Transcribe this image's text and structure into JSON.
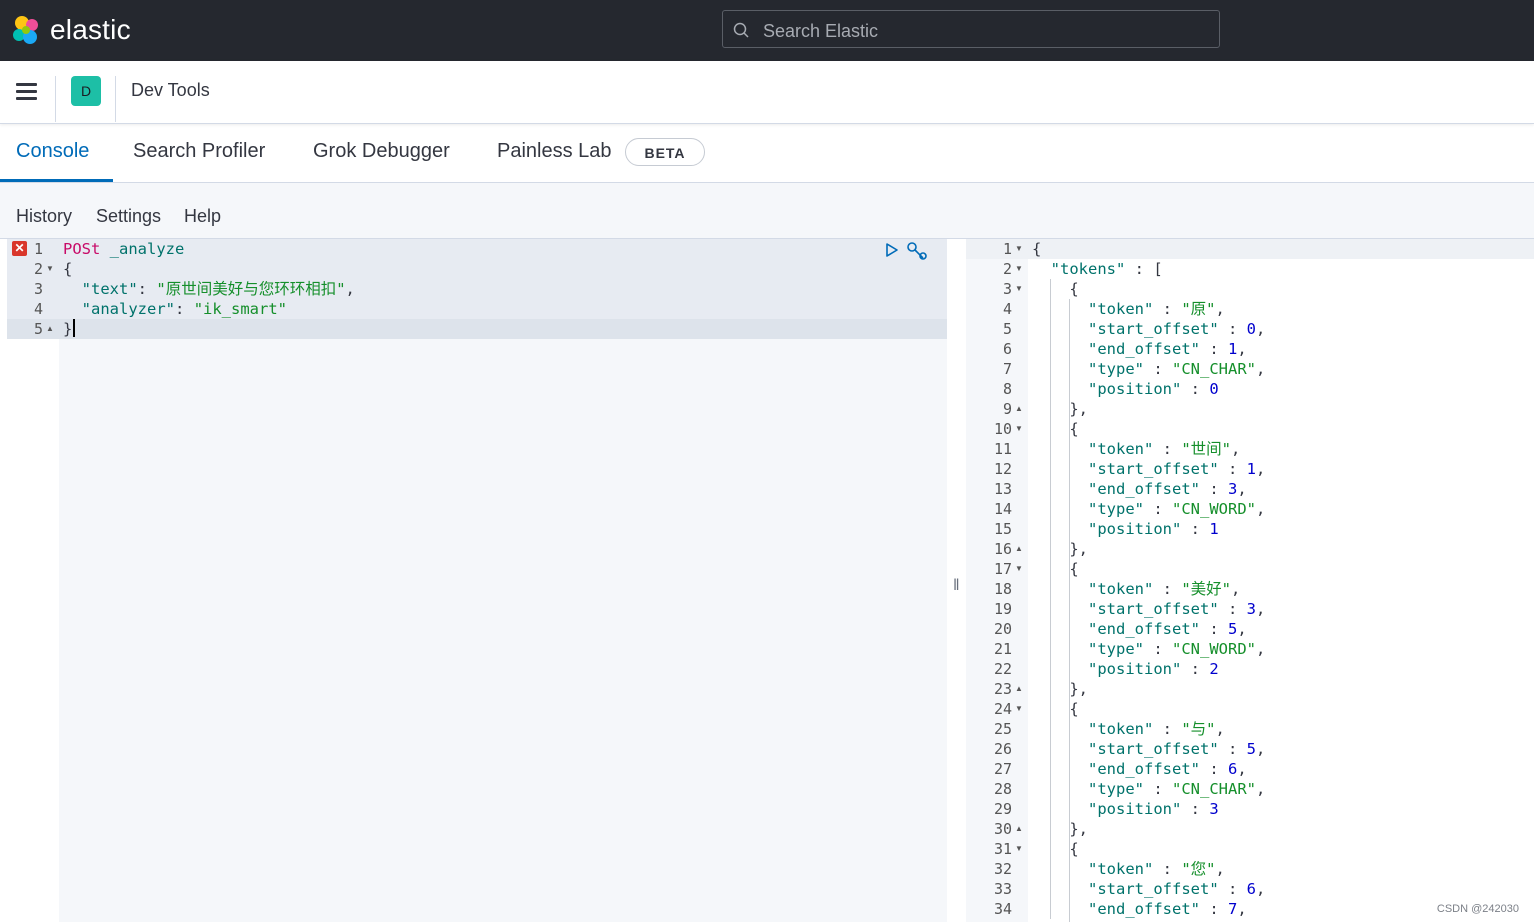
{
  "topbar": {
    "logo_text": "elastic",
    "search_placeholder": "Search Elastic"
  },
  "header": {
    "avatar_initial": "D",
    "app_title": "Dev Tools"
  },
  "tabs": [
    {
      "label": "Console",
      "active": true
    },
    {
      "label": "Search Profiler",
      "active": false
    },
    {
      "label": "Grok Debugger",
      "active": false
    },
    {
      "label": "Painless Lab",
      "active": false
    }
  ],
  "beta_badge": "BETA",
  "toolbar": {
    "history": "History",
    "settings": "Settings",
    "help": "Help"
  },
  "request": {
    "method": "POSt",
    "url": "_analyze",
    "lines": [
      "{",
      "  \"text\": \"原世间美好与您环环相扣\",",
      "  \"analyzer\": \"ik_smart\"",
      "}"
    ]
  },
  "response_lines": [
    "{",
    "  \"tokens\" : [",
    "    {",
    "      \"token\" : \"原\",",
    "      \"start_offset\" : 0,",
    "      \"end_offset\" : 1,",
    "      \"type\" : \"CN_CHAR\",",
    "      \"position\" : 0",
    "    },",
    "    {",
    "      \"token\" : \"世间\",",
    "      \"start_offset\" : 1,",
    "      \"end_offset\" : 3,",
    "      \"type\" : \"CN_WORD\",",
    "      \"position\" : 1",
    "    },",
    "    {",
    "      \"token\" : \"美好\",",
    "      \"start_offset\" : 3,",
    "      \"end_offset\" : 5,",
    "      \"type\" : \"CN_WORD\",",
    "      \"position\" : 2",
    "    },",
    "    {",
    "      \"token\" : \"与\",",
    "      \"start_offset\" : 5,",
    "      \"end_offset\" : 6,",
    "      \"type\" : \"CN_CHAR\",",
    "      \"position\" : 3",
    "    },",
    "    {",
    "      \"token\" : \"您\",",
    "      \"start_offset\" : 6,",
    "      \"end_offset\" : 7,"
  ],
  "watermark": "CSDN @242030",
  "colors": {
    "topbar": "#25282f",
    "accent": "#006bb8",
    "avatar": "#1dbfa6",
    "error": "#d9362b"
  }
}
